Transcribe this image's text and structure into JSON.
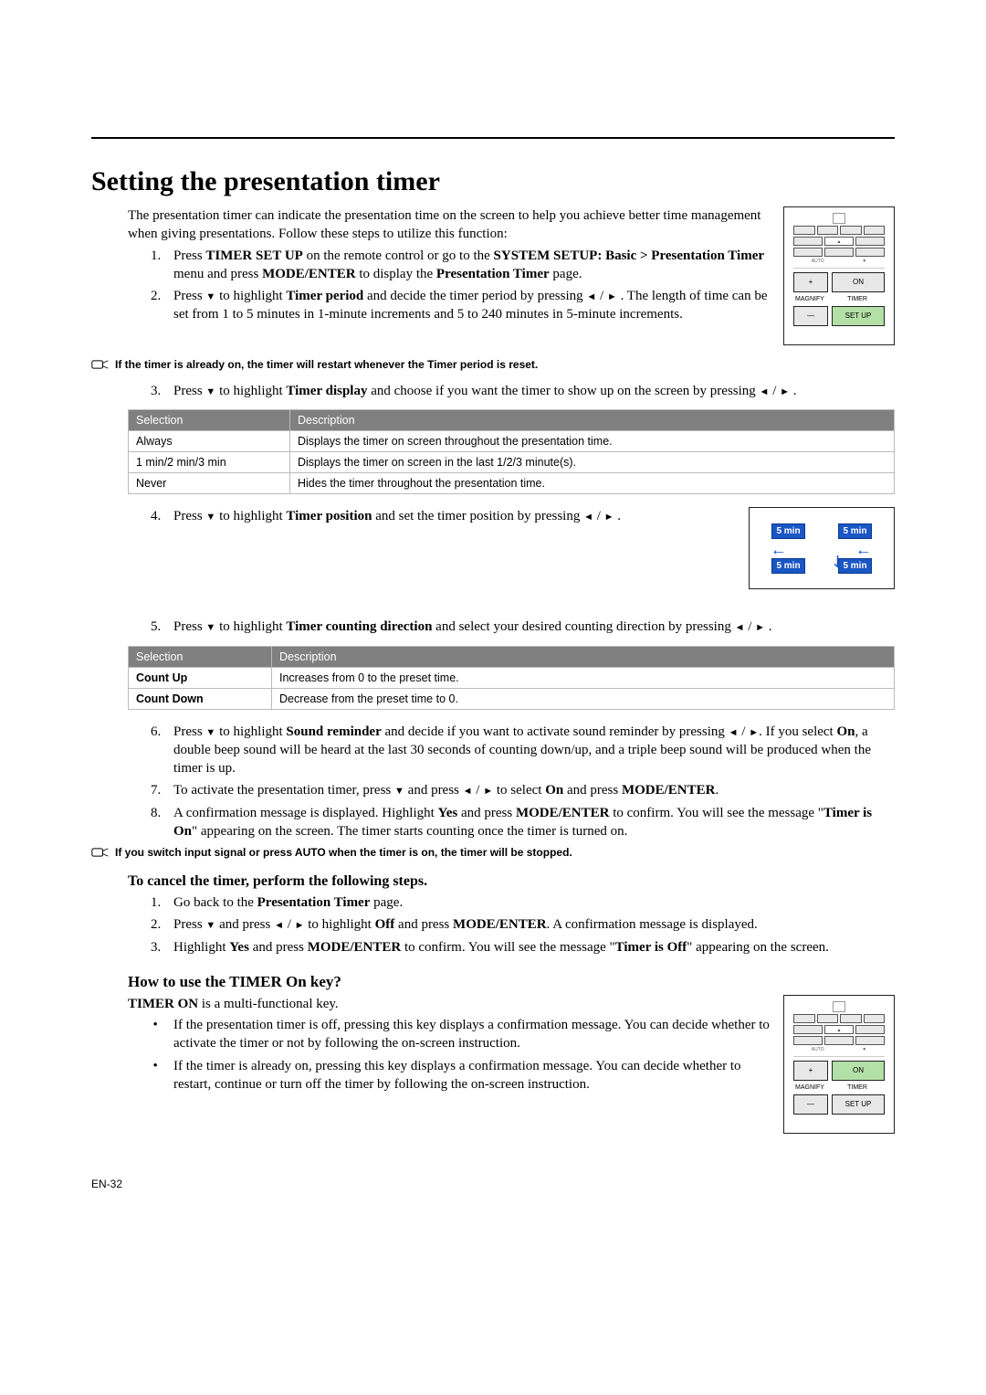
{
  "heading": "Setting the presentation timer",
  "intro": "The presentation timer can indicate the presentation time on the screen to help you achieve better time management when giving presentations. Follow these steps to utilize this function:",
  "steps_a": {
    "s1_a": "Press ",
    "s1_b": "TIMER SET UP",
    "s1_c": " on the remote control or go to the ",
    "s1_d": "SYSTEM SETUP: Basic > Presentation Timer",
    "s1_e": " menu and press ",
    "s1_f": "MODE/ENTER",
    "s1_g": " to display the ",
    "s1_h": "Presentation Timer",
    "s1_i": " page.",
    "s2_a": "Press ",
    "s2_b": " to highlight ",
    "s2_c": "Timer period",
    "s2_d": " and decide the timer period by pressing ",
    "s2_e": " . The length of time can be set from 1 to 5 minutes in 1-minute increments and 5 to 240 minutes in 5-minute increments."
  },
  "notice1": "If the timer is already on, the timer will restart whenever the Timer period is reset.",
  "steps_b": {
    "s3_a": "Press ",
    "s3_b": " to highlight ",
    "s3_c": "Timer display",
    "s3_d": " and choose if you want the timer to show up on the screen by pressing ",
    "s3_e": "."
  },
  "table1": {
    "h1": "Selection",
    "h2": "Description",
    "rows": [
      {
        "c1": "Always",
        "c2": "Displays the timer on screen throughout the presentation time."
      },
      {
        "c1": "1 min/2 min/3 min",
        "c2": "Displays the timer on screen in the last 1/2/3 minute(s)."
      },
      {
        "c1": "Never",
        "c2": "Hides the timer throughout the presentation time."
      }
    ]
  },
  "steps_c": {
    "s4_a": "Press ",
    "s4_b": " to highlight ",
    "s4_c": "Timer position",
    "s4_d": " and set the timer position by pressing ",
    "s4_e": "."
  },
  "pos_labels": {
    "tl": "5 min",
    "tr": "5 min",
    "bl": "5 min",
    "br": "5 min"
  },
  "steps_d": {
    "s5_a": "Press ",
    "s5_b": " to highlight ",
    "s5_c": "Timer counting direction",
    "s5_d": " and select your desired counting direction by pressing ",
    "s5_e": "."
  },
  "table2": {
    "h1": "Selection",
    "h2": "Description",
    "rows": [
      {
        "c1": "Count Up",
        "c2": "Increases from 0 to the preset time."
      },
      {
        "c1": "Count Down",
        "c2": "Decrease from the preset time to 0."
      }
    ]
  },
  "steps_e": {
    "s6_a": "Press ",
    "s6_b": " to highlight ",
    "s6_c": "Sound reminder",
    "s6_d": " and decide if you want to activate sound reminder by pressing ",
    "s6_e": ". If you select ",
    "s6_f": "On",
    "s6_g": ", a double beep sound will be heard at the last 30 seconds of counting down/up, and a triple beep sound will be produced when the timer is up.",
    "s7_a": "To activate the presentation timer, press ",
    "s7_b": " and press ",
    "s7_c": " to select ",
    "s7_d": "On",
    "s7_e": " and press ",
    "s7_f": "MODE/ENTER",
    "s7_g": ".",
    "s8_a": "A confirmation message is displayed. Highlight ",
    "s8_b": "Yes",
    "s8_c": " and press ",
    "s8_d": "MODE/ENTER",
    "s8_e": " to confirm. You will see the message \"",
    "s8_f": "Timer is On",
    "s8_g": "\" appearing on the  screen. The timer starts counting once the timer is turned on."
  },
  "notice2": "If you switch input signal or press AUTO when the timer is on, the timer will be stopped.",
  "cancel_heading": "To cancel the timer, perform the following steps.",
  "cancel_steps": {
    "c1_a": "Go back to the ",
    "c1_b": "Presentation Timer",
    "c1_c": " page.",
    "c2_a": "Press ",
    "c2_b": " and press ",
    "c2_c": " to highlight ",
    "c2_d": "Off",
    "c2_e": " and press ",
    "c2_f": "MODE/ENTER",
    "c2_g": ". A confirmation message is displayed.",
    "c3_a": "Highlight ",
    "c3_b": "Yes",
    "c3_c": " and press ",
    "c3_d": "MODE/ENTER",
    "c3_e": " to confirm. You will see the message \"",
    "c3_f": "Timer is Off",
    "c3_g": "\" appearing on the screen."
  },
  "howto_heading": "How to use the TIMER On key?",
  "howto_lead_a": "TIMER ON",
  "howto_lead_b": " is a multi-functional key.",
  "howto_bullets": {
    "b1": "If the presentation timer is off, pressing this key displays a confirmation message. You can decide whether to activate the timer or not by following the on-screen instruction.",
    "b2": "If the timer is already on, pressing this key displays a confirmation message. You can decide whether to restart, continue or turn off the timer by following the on-screen instruction."
  },
  "remote": {
    "magnify": "MAGNIFY",
    "timer": "TIMER",
    "on": "ON",
    "setup": "SET UP",
    "plus": "+",
    "minus": "—"
  },
  "footer": "EN-32"
}
